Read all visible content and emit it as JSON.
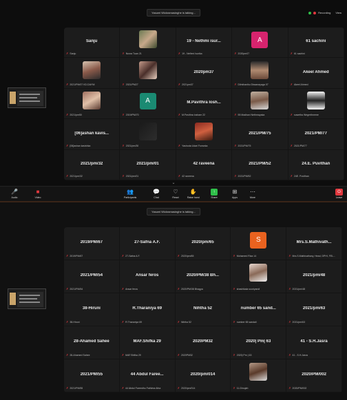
{
  "screen1": {
    "speaker_banner": "Yasumi Wickramasinghe is talking...",
    "recording_label": "Recording",
    "view_label": "View",
    "tiles": [
      {
        "name": "Sanju",
        "label": "Sanju",
        "kind": "text"
      },
      {
        "name": "",
        "label": "Nusra Tuan 21",
        "kind": "photo",
        "photo": "photo-a"
      },
      {
        "name": "19 - Nethmi isur...",
        "label": "19 - Nethmi Isurika",
        "kind": "text"
      },
      {
        "name": "A",
        "label": "2020pm07",
        "kind": "letter",
        "color": "#d6246e"
      },
      {
        "name": "61 sachini",
        "label": "61 sachini",
        "kind": "text"
      },
      {
        "name": "",
        "label": "2021/PM/07 KD.DAYNI",
        "kind": "photo",
        "photo": "photo-b"
      },
      {
        "name": "",
        "label": "2021/PM27",
        "kind": "photo",
        "photo": "photo-c"
      },
      {
        "name": "2020pm37",
        "label": "2021pm37",
        "kind": "text"
      },
      {
        "name": "",
        "label": "Dilmihaniku Dissanayaga 07",
        "kind": "photo",
        "photo": "photo-d"
      },
      {
        "name": "Akeel Ahmed",
        "label": "Akeel Ahmed",
        "kind": "text"
      },
      {
        "name": "",
        "label": "2021/pm50",
        "kind": "photo",
        "photo": "photo-e"
      },
      {
        "name": "A",
        "label": "2019/PM/70",
        "kind": "letter",
        "color": "#1a8a72"
      },
      {
        "name": "M.Pavithra  losh...",
        "label": "M.Pavithra losham 22",
        "kind": "text"
      },
      {
        "name": "",
        "label": "55 Madhavi Nethmayaka",
        "kind": "photo",
        "photo": "photo-f"
      },
      {
        "name": "",
        "label": "suwetha Wegerthneme",
        "kind": "photo",
        "photo": "photo-g"
      },
      {
        "name": "[06]ashan  kavis...",
        "label": "[06]ashan kavishka",
        "kind": "text"
      },
      {
        "name": "",
        "label": "2021/pm/30",
        "kind": "photo",
        "photo": "photo-h"
      },
      {
        "name": "",
        "label": "Yashoda Udari Fonseka",
        "kind": "photo",
        "photo": "photo-i"
      },
      {
        "name": "2021/PM/75",
        "label": "2021/PM/75",
        "kind": "text"
      },
      {
        "name": "2021/PM/77",
        "label": "2021/PM/77",
        "kind": "text"
      },
      {
        "name": "2021/pm/32",
        "label": "2021/pm/32",
        "kind": "text"
      },
      {
        "name": "2021/pm/01",
        "label": "2021/pm/01",
        "kind": "text"
      },
      {
        "name": "42 raveena",
        "label": "42 raveena",
        "kind": "text"
      },
      {
        "name": "2021/PM/52",
        "label": "2021/PM/52",
        "kind": "text"
      },
      {
        "name": "24.E. Puvithan",
        "label": "24E. Puvithan",
        "kind": "text"
      }
    ],
    "toolbar": {
      "audio": "Audio",
      "video": "Video",
      "participants": "Participants",
      "chat": "Chat",
      "react": "React",
      "raise_hand": "Raise hand",
      "share": "Share",
      "apps": "Apps",
      "more": "More",
      "leave": "Leave",
      "participants_count": "43"
    }
  },
  "screen2": {
    "speaker_banner": "Yasumi Wickramasinghe is talking...",
    "tiles": [
      {
        "name": "2019/PM/67",
        "label": "2019/PM/67",
        "kind": "text"
      },
      {
        "name": "27-Safna A.F.",
        "label": "27-Safna A.F.",
        "kind": "text"
      },
      {
        "name": "2020/pm/65",
        "label": "2020/pm/65",
        "kind": "text"
      },
      {
        "name": "S",
        "label": "Mohamed Riza 14",
        "kind": "letter",
        "color": "#e9621f"
      },
      {
        "name": "Mrs.S.Mathivath...",
        "label": "Mrs.S.Mathivathany, Head, DPHI, FEL...",
        "kind": "text"
      },
      {
        "name": "2021/PM/54",
        "label": "2021/PM/54",
        "kind": "text"
      },
      {
        "name": "Ansar feros",
        "label": "Ansar feros",
        "kind": "text"
      },
      {
        "name": "2020/PM/38  Bh...",
        "label": "2020/PM/38 Bhagya",
        "kind": "text"
      },
      {
        "name": "",
        "label": "shashikala sooriyandi",
        "kind": "photo",
        "photo": "photo-j"
      },
      {
        "name": "2021/pm/48",
        "label": "2021/pm/48",
        "kind": "text"
      },
      {
        "name": "38-Hiruni",
        "label": "38-Hiruni",
        "kind": "text"
      },
      {
        "name": "R.Tharaniya  69",
        "label": "R.Tharaniya 69",
        "kind": "text"
      },
      {
        "name": "Nihtha  52",
        "label": "Nihtha 52",
        "kind": "text"
      },
      {
        "name": "number  65  sand...",
        "label": "number 65 sandali",
        "kind": "text"
      },
      {
        "name": "2021/pm/63",
        "label": "2021/pm/63",
        "kind": "text"
      },
      {
        "name": "28-Ahamed  Sahee",
        "label": "28-Ahamed Sahee",
        "kind": "text"
      },
      {
        "name": "MAF.Shifka  29",
        "label": "MAF.Shifka 29",
        "kind": "text"
      },
      {
        "name": "2020PM32",
        "label": "2020PM32",
        "kind": "text"
      },
      {
        "name": "2020|  Pm|  63",
        "label": "2020| Pm | 63",
        "kind": "text"
      },
      {
        "name": "41 - S.H.Jasra",
        "label": "41 - S.H.Jasra",
        "kind": "text"
      },
      {
        "name": "2021/PM/55",
        "label": "2021/PM/55",
        "kind": "text"
      },
      {
        "name": "44  Abdul  Faree...",
        "label": "44 Abdul Fareedhu Fathima Afna",
        "kind": "text"
      },
      {
        "name": "2020/pm/014",
        "label": "2020/pm/014",
        "kind": "text"
      },
      {
        "name": "",
        "label": "11-Dinujah",
        "kind": "photo",
        "photo": "photo-k"
      },
      {
        "name": "2020/PM/002",
        "label": "2020/PM/002",
        "kind": "text"
      }
    ]
  },
  "colors": {
    "grid_bg": "#1c1c1c",
    "muted_red": "#e0383e",
    "share_green": "#2fbf4a"
  }
}
